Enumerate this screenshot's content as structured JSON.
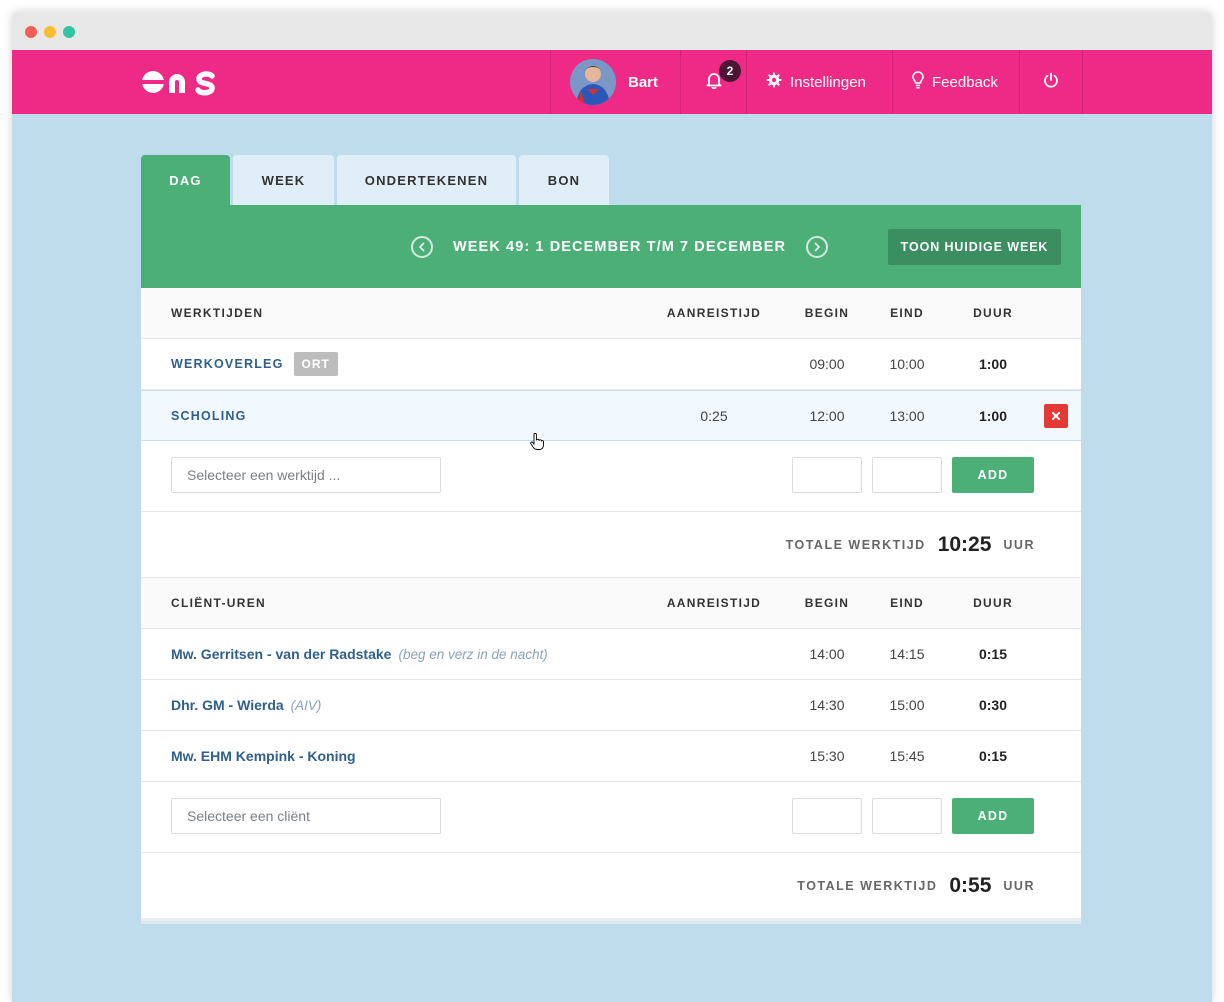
{
  "brand": {
    "logo_text": "ons",
    "accent_color": "#ef2a86",
    "success_color": "#4caf78",
    "danger_color": "#e53935"
  },
  "nav": {
    "user_name": "Bart",
    "notification_count": "2",
    "settings_label": "Instellingen",
    "feedback_label": "Feedback"
  },
  "tabs": [
    {
      "label": "DAG",
      "active": true
    },
    {
      "label": "WEEK",
      "active": false
    },
    {
      "label": "ONDERTEKENEN",
      "active": false
    },
    {
      "label": "BON",
      "active": false
    }
  ],
  "week": {
    "label": "WEEK 49: 1 DECEMBER T/M 7 DECEMBER",
    "current_week_button": "TOON HUIDIGE WEEK"
  },
  "worktimes": {
    "header": {
      "name": "WERKTIJDEN",
      "travel": "AANREISTIJD",
      "begin": "BEGIN",
      "end": "EIND",
      "duration": "DUUR"
    },
    "rows": [
      {
        "name": "WERKOVERLEG",
        "tag": "ORT",
        "travel": "",
        "begin": "09:00",
        "end": "10:00",
        "duration": "1:00"
      },
      {
        "name": "SCHOLING",
        "tag": "",
        "travel": "0:25",
        "begin": "12:00",
        "end": "13:00",
        "duration": "1:00"
      }
    ],
    "select_placeholder": "Selecteer een werktijd ...",
    "add_label": "ADD",
    "total_label": "TOTALE WERKTIJD",
    "total_value": "10:25",
    "total_unit": "UUR"
  },
  "clients": {
    "header": {
      "name": "CLIËNT-UREN",
      "travel": "AANREISTIJD",
      "begin": "BEGIN",
      "end": "EIND",
      "duration": "DUUR"
    },
    "rows": [
      {
        "name": "Mw. Gerritsen - van der Radstake",
        "note": "(beg en verz in de nacht)",
        "begin": "14:00",
        "end": "14:15",
        "duration": "0:15"
      },
      {
        "name": "Dhr. GM - Wierda",
        "note": "(AIV)",
        "begin": "14:30",
        "end": "15:00",
        "duration": "0:30"
      },
      {
        "name": "Mw. EHM Kempink - Koning",
        "note": "",
        "begin": "15:30",
        "end": "15:45",
        "duration": "0:15"
      }
    ],
    "select_placeholder": "Selecteer een cliënt",
    "add_label": "ADD",
    "total_label": "TOTALE WERKTIJD",
    "total_value": "0:55",
    "total_unit": "UUR"
  },
  "icons": {
    "notification": "bell-icon",
    "settings": "gear-icon",
    "feedback": "lightbulb-icon",
    "logout": "power-icon",
    "prev_week": "chevron-left-icon",
    "next_week": "chevron-right-icon",
    "delete": "close-icon"
  }
}
